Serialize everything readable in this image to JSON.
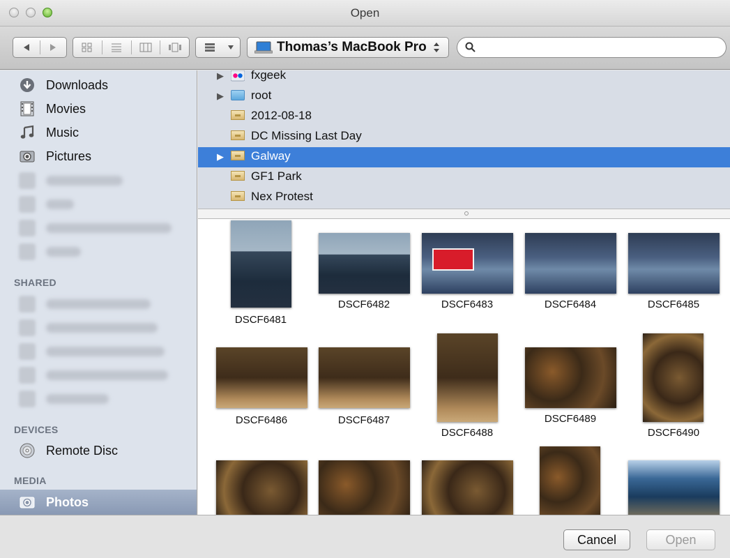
{
  "window": {
    "title": "Open"
  },
  "toolbar": {
    "location": "Thomas’s MacBook Pro",
    "search_value": ""
  },
  "sidebar": {
    "favorites": [
      {
        "label": "Downloads",
        "icon": "download-icon"
      },
      {
        "label": "Movies",
        "icon": "film-icon"
      },
      {
        "label": "Music",
        "icon": "music-note-icon"
      },
      {
        "label": "Pictures",
        "icon": "camera-icon"
      }
    ],
    "shared_heading": "SHARED",
    "devices_heading": "DEVICES",
    "devices": [
      {
        "label": "Remote Disc",
        "icon": "disc-icon"
      }
    ],
    "media_heading": "MEDIA",
    "media": [
      {
        "label": "Photos",
        "icon": "camera-icon",
        "selected": true
      }
    ]
  },
  "browser": {
    "rows": [
      {
        "name": "fxgeek",
        "icon": "flickr-icon",
        "expandable": true
      },
      {
        "name": "root",
        "icon": "folder-icon",
        "expandable": true
      },
      {
        "name": "2012-08-18",
        "icon": "event-icon",
        "expandable": false
      },
      {
        "name": "DC Missing Last Day",
        "icon": "event-icon",
        "expandable": false
      },
      {
        "name": "Galway",
        "icon": "event-icon",
        "expandable": true,
        "selected": true
      },
      {
        "name": "GF1 Park",
        "icon": "event-icon",
        "expandable": false
      },
      {
        "name": "Nex Protest",
        "icon": "event-icon",
        "expandable": false
      }
    ]
  },
  "photos": [
    {
      "name": "DSCF6481"
    },
    {
      "name": "DSCF6482"
    },
    {
      "name": "DSCF6483"
    },
    {
      "name": "DSCF6484"
    },
    {
      "name": "DSCF6485"
    },
    {
      "name": "DSCF6486"
    },
    {
      "name": "DSCF6487"
    },
    {
      "name": "DSCF6488"
    },
    {
      "name": "DSCF6489"
    },
    {
      "name": "DSCF6490"
    }
  ],
  "buttons": {
    "cancel": "Cancel",
    "open": "Open"
  },
  "colors": {
    "selection": "#3d7fd9",
    "sidebar_bg": "#dde3ec"
  }
}
